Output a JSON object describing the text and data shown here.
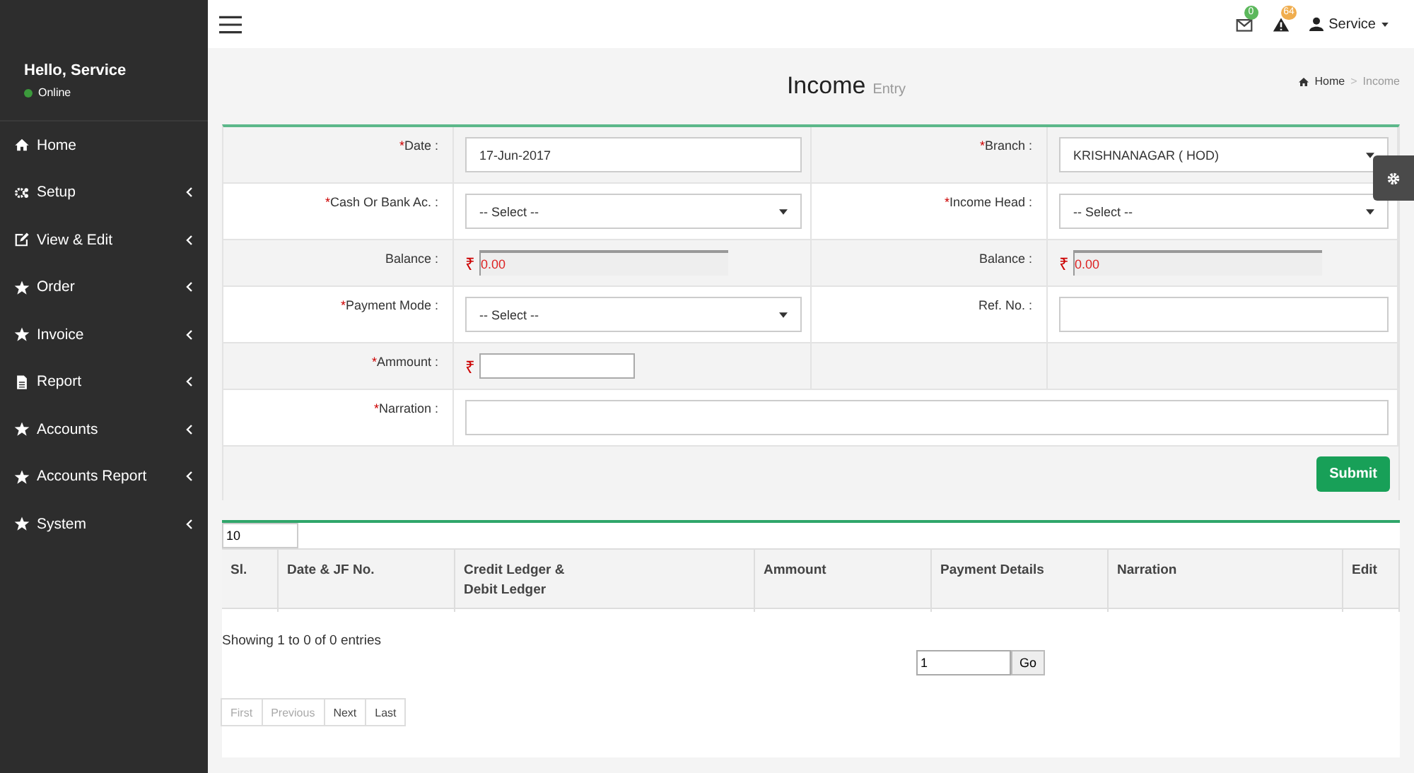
{
  "sidebar": {
    "greeting": "Hello, Service",
    "status": {
      "label": "Online",
      "online": true
    },
    "items": [
      {
        "kind": "home",
        "label": "Home",
        "expandable": false
      },
      {
        "kind": "gears",
        "label": "Setup",
        "expandable": true
      },
      {
        "kind": "edit",
        "label": "View & Edit",
        "expandable": true
      },
      {
        "kind": "star",
        "label": "Order",
        "expandable": true
      },
      {
        "kind": "star",
        "label": "Invoice",
        "expandable": true
      },
      {
        "kind": "file",
        "label": "Report",
        "expandable": true
      },
      {
        "kind": "star",
        "label": "Accounts",
        "expandable": true
      },
      {
        "kind": "star",
        "label": "Accounts Report",
        "expandable": true
      },
      {
        "kind": "star",
        "label": "System",
        "expandable": true
      }
    ]
  },
  "topbar": {
    "notifications": [
      {
        "kind": "mail",
        "count": "0",
        "color": "#5cb85c"
      },
      {
        "kind": "warning",
        "count": "64",
        "color": "#f0ad4e"
      }
    ],
    "user": "Service"
  },
  "header": {
    "title": "Income",
    "subtitle": "Entry",
    "breadcrumb_separator": ">",
    "breadcrumb": [
      {
        "label": "Home",
        "current": false
      },
      {
        "label": "Income",
        "current": true
      }
    ]
  },
  "form": {
    "rows": [
      [
        {
          "label": "Date :",
          "required_mark": "*",
          "kind": "text",
          "value": "17-Jun-2017"
        },
        {
          "label": "Branch :",
          "required_mark": "*",
          "kind": "select",
          "value": "KRISHNANAGAR ( HOD)"
        }
      ],
      [
        {
          "label": "Cash Or Bank Ac. :",
          "required_mark": "*",
          "kind": "select",
          "value": "-- Select --"
        },
        {
          "label": "Income Head :",
          "required_mark": "*",
          "kind": "select",
          "value": "-- Select --"
        }
      ],
      [
        {
          "label": "Balance :",
          "kind": "balance",
          "currency": "₹",
          "value": "0.00"
        },
        {
          "label": "Balance :",
          "kind": "balance",
          "currency": "₹",
          "value": "0.00"
        }
      ],
      [
        {
          "label": "Payment Mode :",
          "required_mark": "*",
          "kind": "select",
          "value": "-- Select --"
        },
        {
          "label": "Ref. No. :",
          "kind": "text"
        }
      ],
      [
        {
          "label": "Ammount :",
          "required_mark": "*",
          "kind": "amount",
          "currency": "₹"
        },
        {
          "kind": "empty"
        }
      ],
      [
        {
          "label": "Narration :",
          "required_mark": "*",
          "kind": "wide"
        }
      ]
    ],
    "submit": "Submit"
  },
  "table": {
    "page_size": "10",
    "columns": [
      "Sl.",
      "Date & JF No.",
      "Credit Ledger &\nDebit Ledger",
      "Ammount",
      "Payment Details",
      "Narration",
      "Edit"
    ],
    "info": "Showing 1 to 0 of 0 entries",
    "page_input": "1",
    "go": "Go",
    "pagination": [
      {
        "label": "First",
        "disabled": true
      },
      {
        "label": "Previous",
        "disabled": true
      },
      {
        "label": "Next",
        "disabled": false
      },
      {
        "label": "Last",
        "disabled": false
      }
    ]
  }
}
